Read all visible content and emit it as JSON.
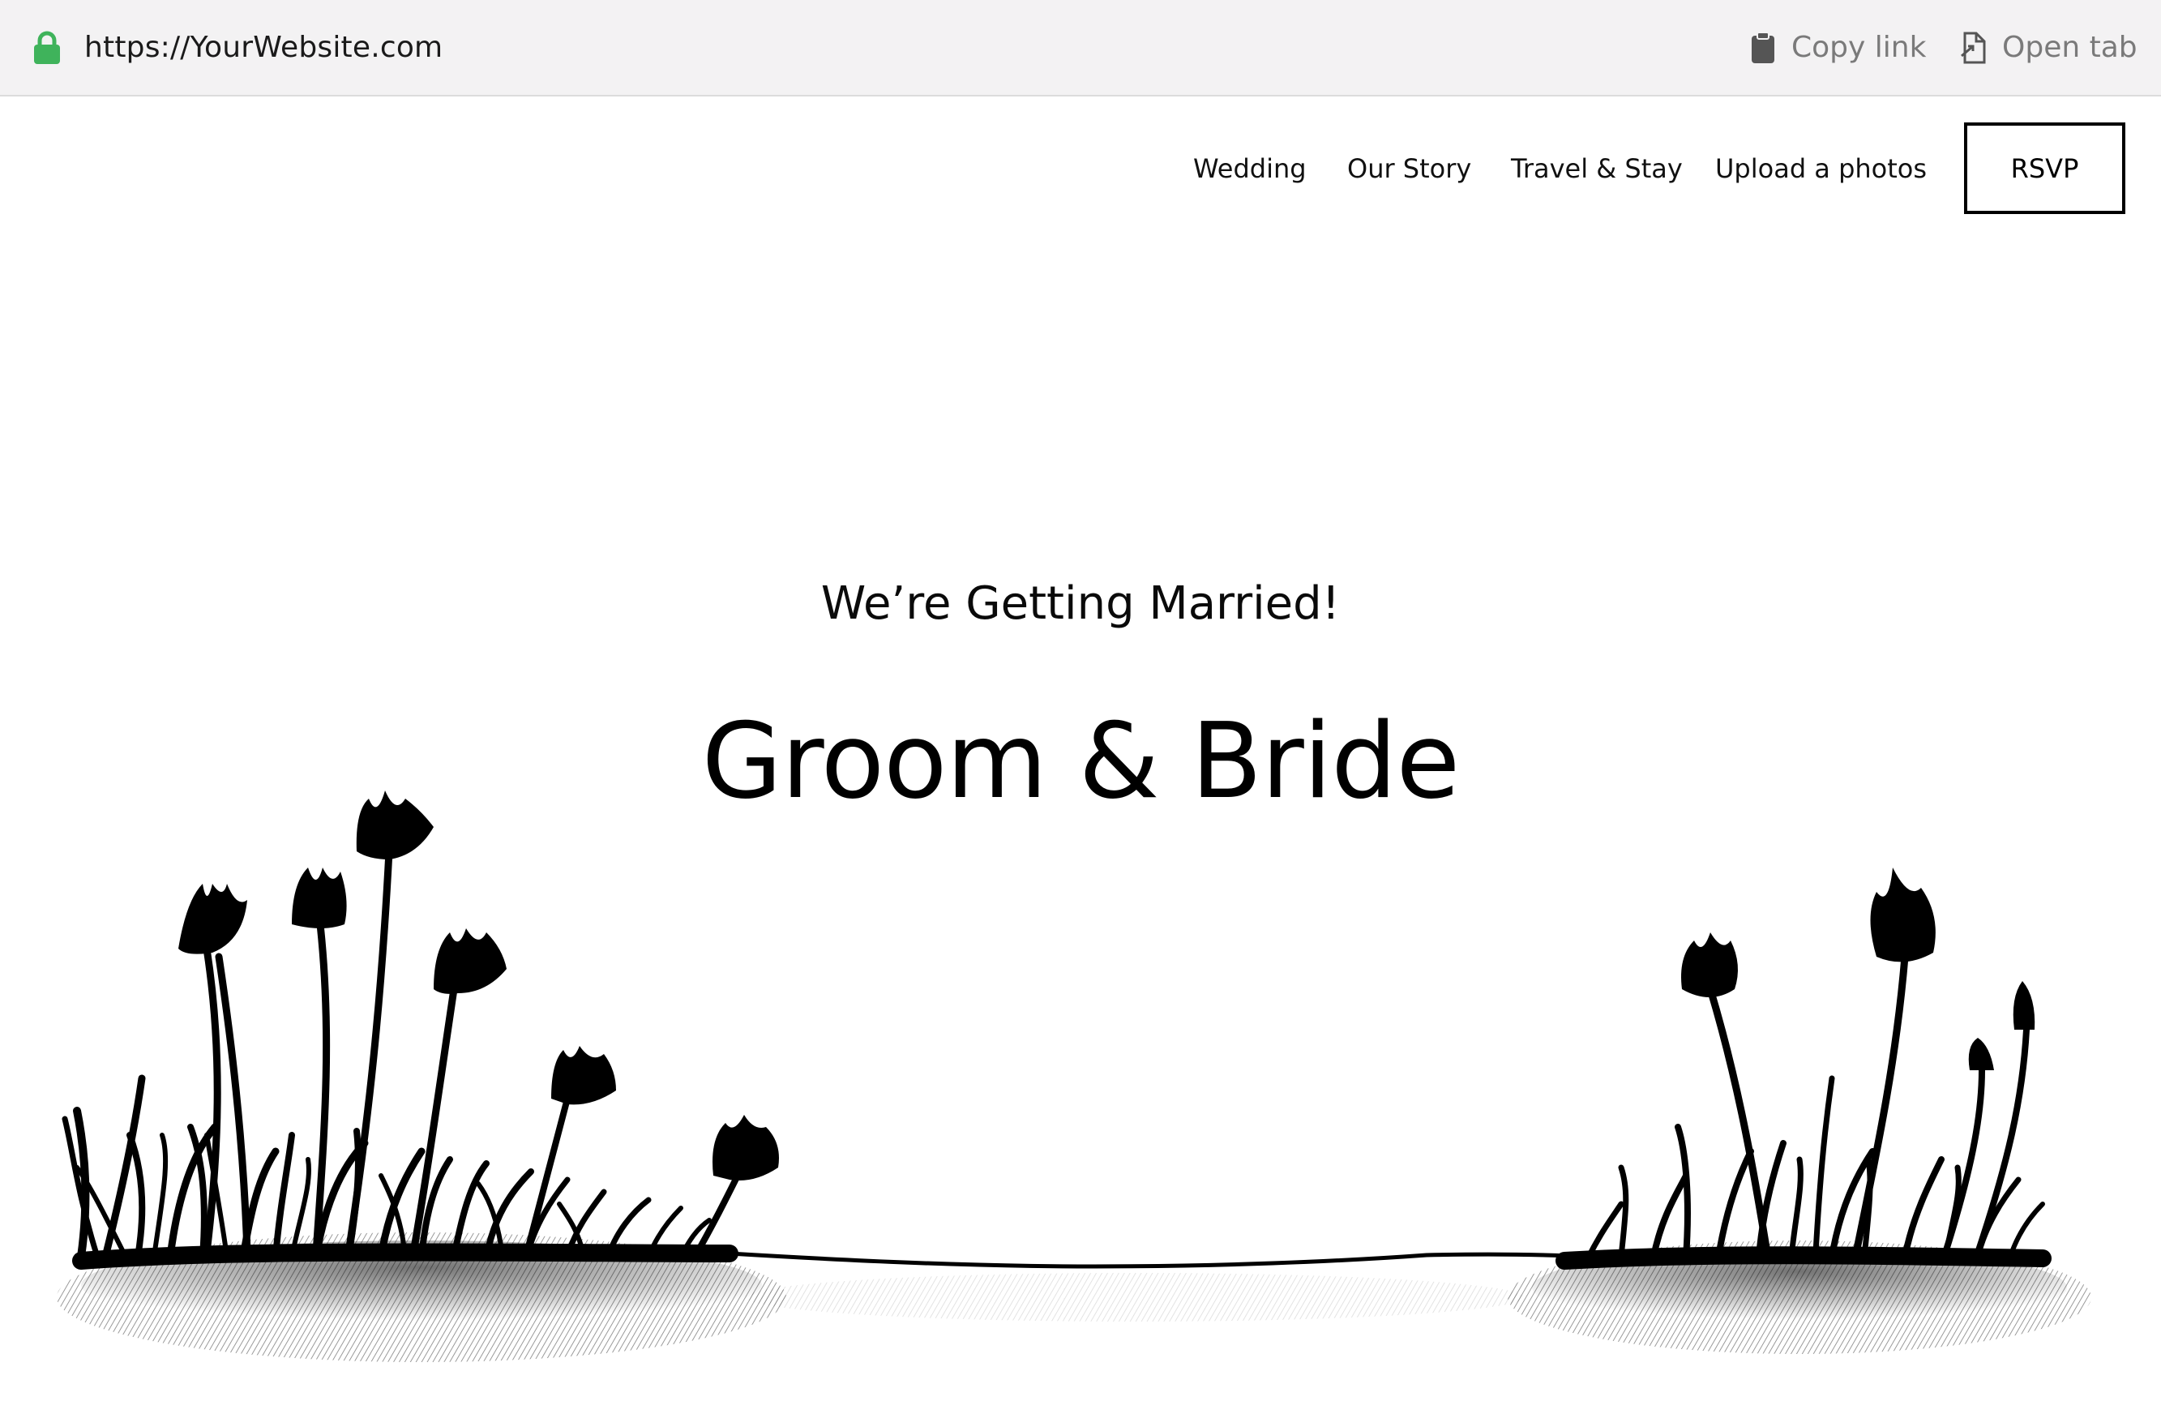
{
  "browser": {
    "url": "https://YourWebsite.com",
    "copy_link_label": "Copy link",
    "open_tab_label": "Open tab",
    "lock_color": "#3fb35b"
  },
  "nav": {
    "items": [
      "Wedding",
      "Our Story",
      "Travel & Stay",
      "Upload a photos"
    ],
    "rsvp_label": "RSVP"
  },
  "hero": {
    "subtitle": "We’re Getting Married!",
    "names": "Groom & Bride"
  },
  "illustration": {
    "subject": "hand-drawn wildflowers and grass on a ground line",
    "color": "#000000"
  }
}
